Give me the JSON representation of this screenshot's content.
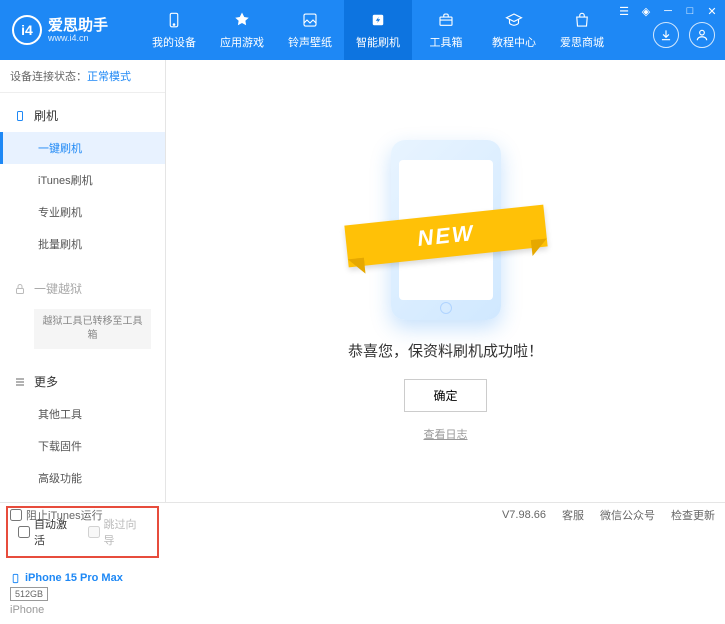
{
  "app": {
    "name": "爱思助手",
    "url": "www.i4.cn"
  },
  "nav": [
    {
      "label": "我的设备"
    },
    {
      "label": "应用游戏"
    },
    {
      "label": "铃声壁纸"
    },
    {
      "label": "智能刷机"
    },
    {
      "label": "工具箱"
    },
    {
      "label": "教程中心"
    },
    {
      "label": "爱思商城"
    }
  ],
  "status": {
    "label": "设备连接状态：",
    "value": "正常模式"
  },
  "sidebar": {
    "flash": {
      "header": "刷机",
      "items": [
        "一键刷机",
        "iTunes刷机",
        "专业刷机",
        "批量刷机"
      ]
    },
    "jailbreak": {
      "header": "一键越狱",
      "note": "越狱工具已转移至工具箱"
    },
    "more": {
      "header": "更多",
      "items": [
        "其他工具",
        "下载固件",
        "高级功能"
      ]
    }
  },
  "checkboxes": {
    "auto_activate": "自动激活",
    "skip_guide": "跳过向导"
  },
  "device": {
    "name": "iPhone 15 Pro Max",
    "storage": "512GB",
    "type": "iPhone"
  },
  "main": {
    "ribbon": "NEW",
    "success_text": "恭喜您，保资料刷机成功啦！",
    "ok_button": "确定",
    "log_link": "查看日志"
  },
  "footer": {
    "block_itunes": "阻止iTunes运行",
    "version": "V7.98.66",
    "links": [
      "客服",
      "微信公众号",
      "检查更新"
    ]
  }
}
